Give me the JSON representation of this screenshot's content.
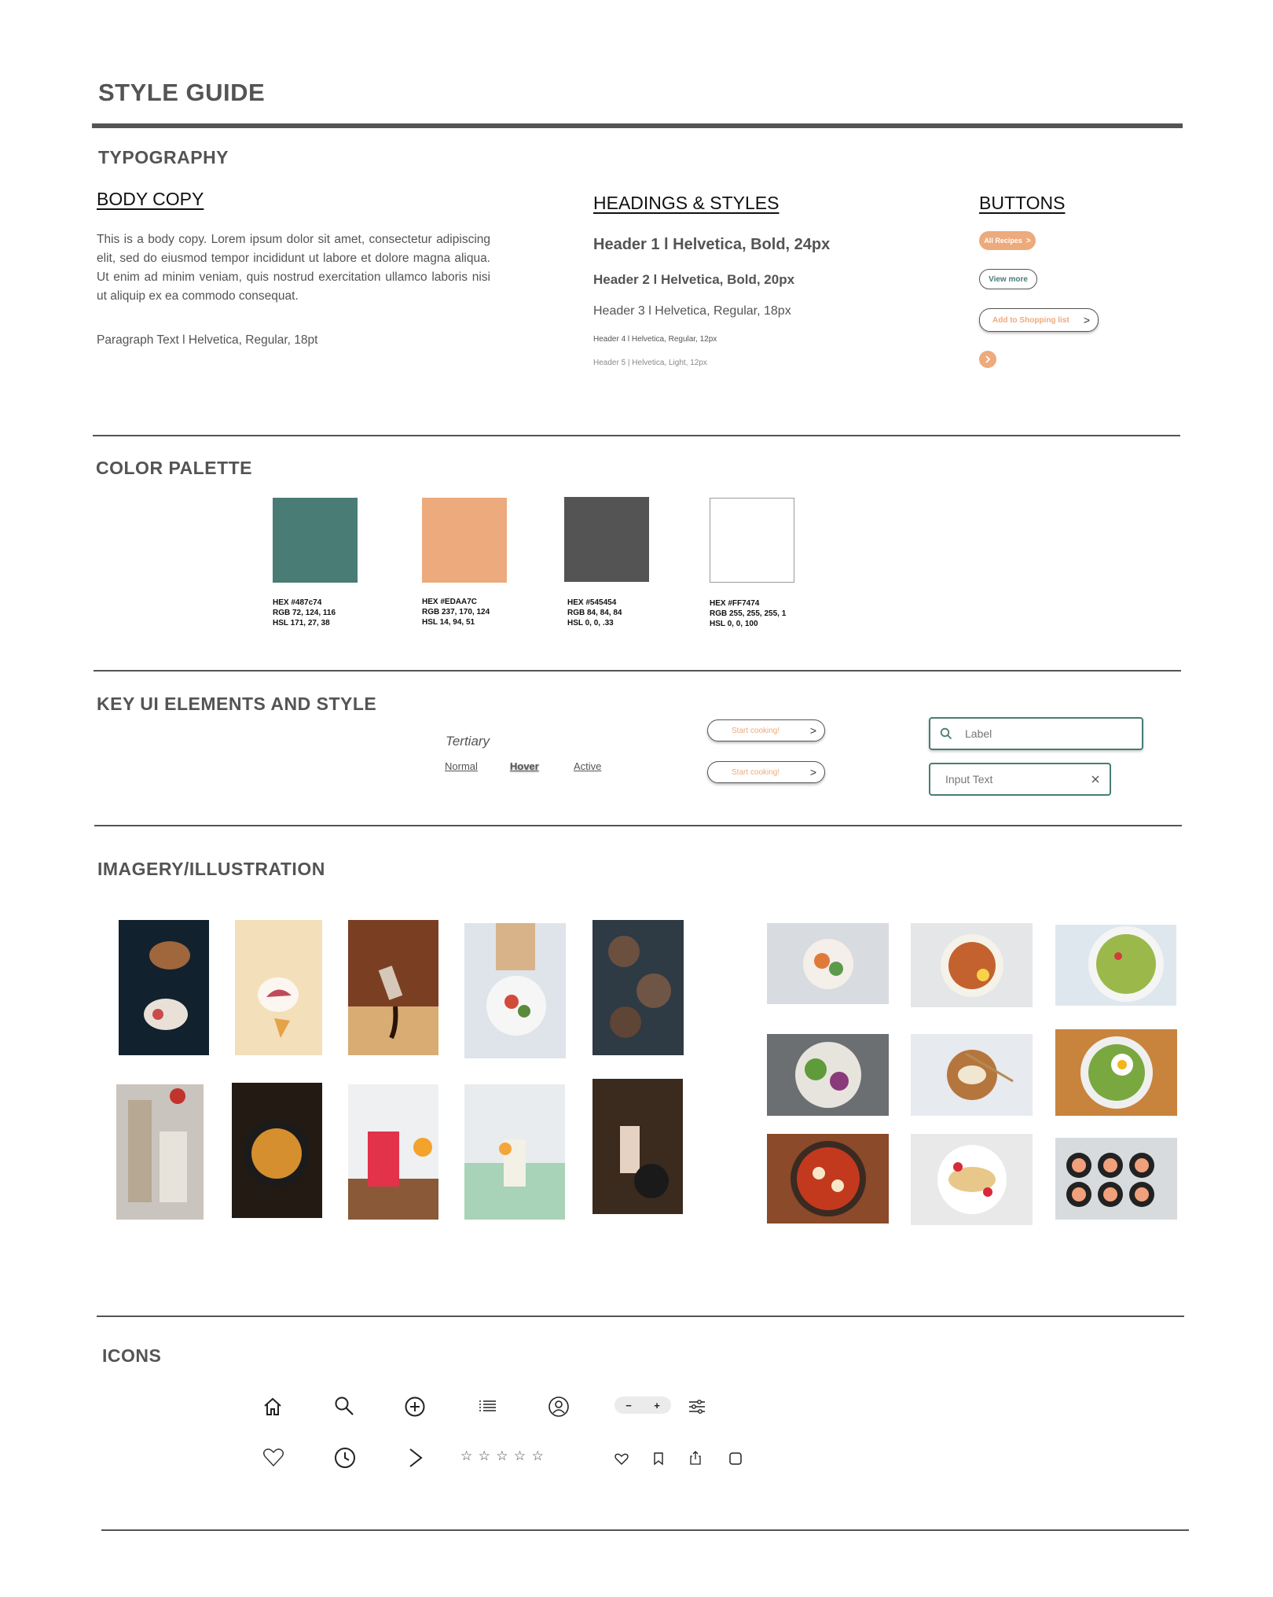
{
  "page_title": "STYLE GUIDE",
  "typography": {
    "section_title": "TYPOGRAPHY",
    "body_copy": {
      "heading": "BODY COPY",
      "text": "This is a body copy. Lorem ipsum dolor sit amet, consectetur adipiscing elit, sed do eiusmod tempor incididunt ut labore et dolore magna aliqua. Ut enim ad minim veniam, quis nostrud exercitation ullamco laboris nisi ut aliquip ex ea commodo consequat.",
      "paragraph_spec": "Paragraph Text l Helvetica, Regular, 18pt"
    },
    "headings": {
      "heading": "HEADINGS & STYLES",
      "h1": "Header 1 l Helvetica, Bold, 24px",
      "h2": "Header 2 l Helvetica, Bold, 20px",
      "h3": "Header 3 l Helvetica, Regular, 18px",
      "h4": "Header 4 l Helvetica, Regular, 12px",
      "h5": "Header 5 | Helvetica, Light, 12px"
    },
    "buttons": {
      "heading": "BUTTONS",
      "all_recipes": "All Recipes",
      "view_more": "View more",
      "add_to_list": "Add to Shopping list",
      "arrow": ">"
    }
  },
  "palette": {
    "section_title": "COLOR PALETTE",
    "colors": [
      {
        "color": "#487c74",
        "hex": "HEX #487c74",
        "rgb": "RGB 72, 124, 116",
        "hsl": "HSL 171, 27, 38"
      },
      {
        "color": "#EDAA7C",
        "hex": "HEX #EDAA7C",
        "rgb": "RGB 237, 170, 124",
        "hsl": "HSL 14, 94, 51"
      },
      {
        "color": "#545454",
        "hex": "HEX #545454",
        "rgb": "RGB 84, 84, 84",
        "hsl": "HSL 0, 0, .33"
      },
      {
        "color": "#FFFFFF",
        "hex": "HEX #FF7474",
        "rgb": "RGB 255, 255, 255, 1",
        "hsl": "HSL 0, 0, 100"
      }
    ]
  },
  "ui_elements": {
    "section_title": "KEY UI ELEMENTS AND STYLE",
    "tertiary_label": "Tertiary",
    "states": {
      "normal": "Normal",
      "hover": "Hover",
      "active": "Active"
    },
    "start_button": "Start cooking!",
    "search_placeholder": "Label",
    "input_value": "Input Text"
  },
  "imagery": {
    "section_title": "IMAGERY/ILLUSTRATION"
  },
  "icons": {
    "section_title": "ICONS",
    "stepper_minus": "−",
    "stepper_plus": "+",
    "stars": "☆ ☆ ☆ ☆ ☆"
  },
  "colors": {
    "teal": "#487c74",
    "peach": "#EDAA7C",
    "charcoal": "#545454"
  }
}
